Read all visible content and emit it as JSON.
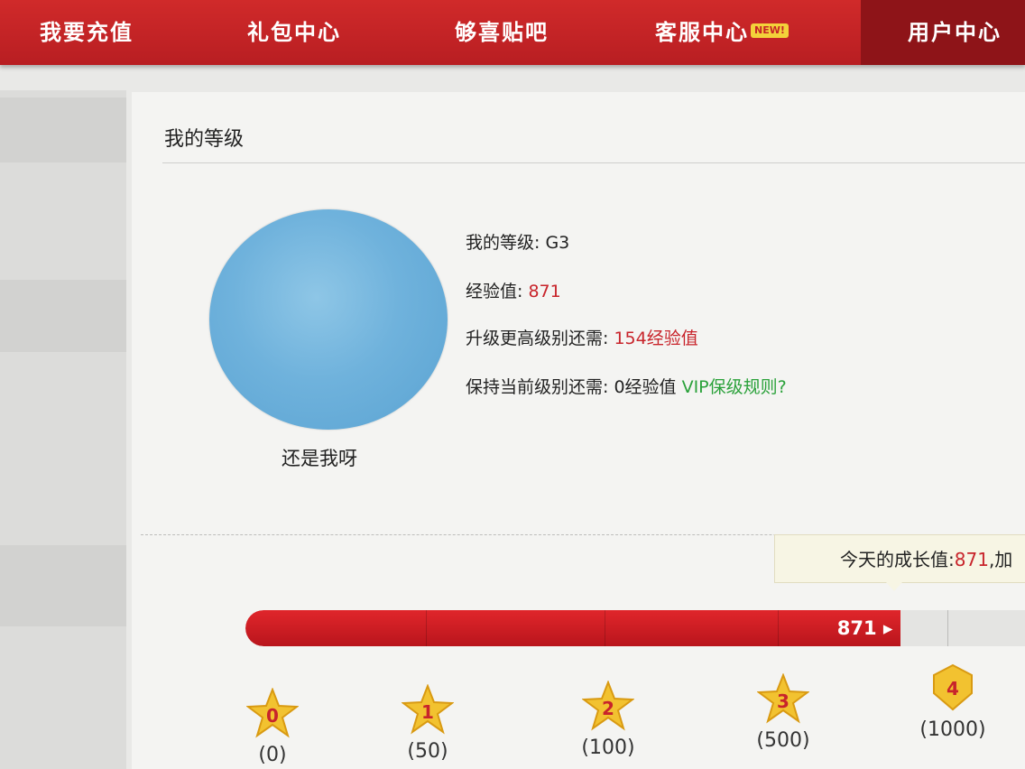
{
  "nav": {
    "items": [
      {
        "label": "我要充值"
      },
      {
        "label": "礼包中心"
      },
      {
        "label": "够喜贴吧"
      },
      {
        "label": "客服中心",
        "badge": "NEW!"
      },
      {
        "label": "用户中心"
      }
    ]
  },
  "panel": {
    "title": "我的等级"
  },
  "profile": {
    "nickname": "还是我呀",
    "level_label": "我的等级: ",
    "level_value": "G3",
    "exp_label": "经验值: ",
    "exp_value": "871",
    "upgrade_label": "升级更高级别还需: ",
    "upgrade_value": "154经验值",
    "keep_label": "保持当前级别还需: 0经验值 ",
    "keep_link": "VIP保级规则?"
  },
  "growth": {
    "tooltip_label": "今天的成长值:",
    "tooltip_value": "871",
    "tooltip_suffix": ",加",
    "bar_label": "871 ▸",
    "progress_fraction": 0.84
  },
  "levels": [
    {
      "num": "0",
      "req": "(0)"
    },
    {
      "num": "1",
      "req": "(50)"
    },
    {
      "num": "2",
      "req": "(100)"
    },
    {
      "num": "3",
      "req": "(500)"
    },
    {
      "num": "4",
      "req": "(1000)"
    }
  ],
  "colors": {
    "nav_red": "#c62426",
    "accent_red": "#c8242b",
    "link_green": "#2aa13a",
    "star_gold": "#f2c230"
  }
}
